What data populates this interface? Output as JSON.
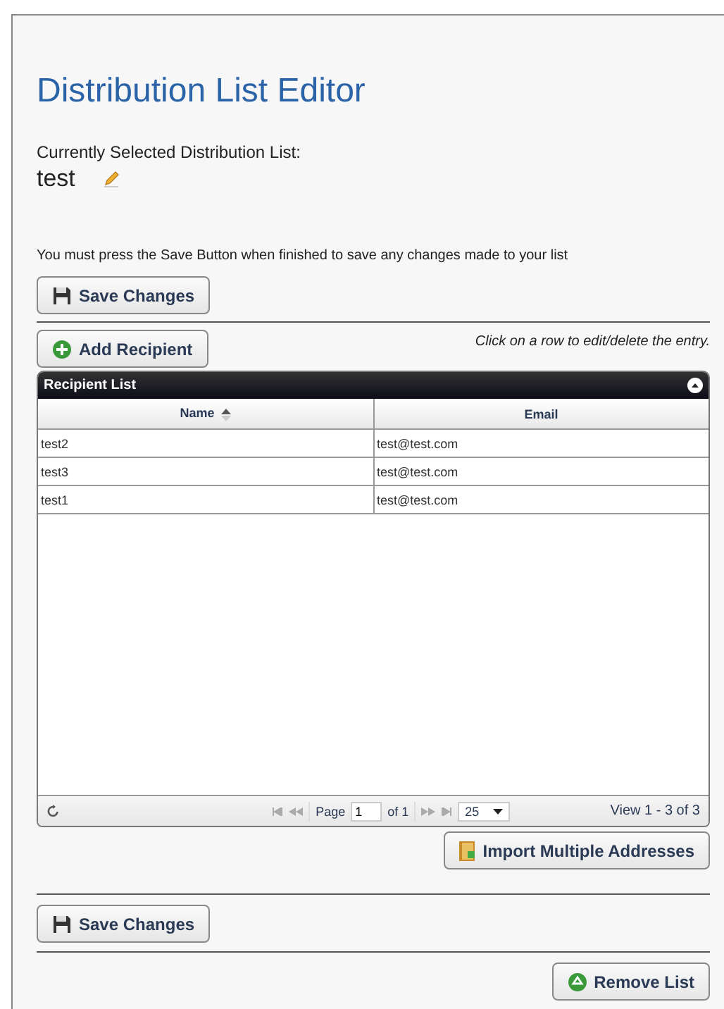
{
  "title": "Distribution List Editor",
  "current_list": {
    "label": "Currently Selected Distribution List:",
    "name": "test"
  },
  "notice": "You must press the Save Button when finished to save any changes made to your list",
  "save_button_top": {
    "label": "Save Changes"
  },
  "add_button": {
    "label": "Add Recipient"
  },
  "hint": "Click on a row to edit/delete the entry.",
  "grid": {
    "caption": "Recipient List",
    "columns": [
      {
        "label": "Name",
        "sorted": true
      },
      {
        "label": "Email",
        "sorted": false
      }
    ],
    "rows": [
      [
        "test2",
        "test@test.com"
      ],
      [
        "test3",
        "test@test.com"
      ],
      [
        "test1",
        "test@test.com"
      ]
    ],
    "pager": {
      "page_label": "Page",
      "page": "1",
      "of": "of 1",
      "page_size": "25",
      "view": "View 1 - 3 of 3"
    }
  },
  "import_button": {
    "label": "Import Multiple Addresses"
  },
  "save_button_bottom": {
    "label": "Save Changes"
  },
  "remove_button": {
    "label": "Remove List"
  }
}
